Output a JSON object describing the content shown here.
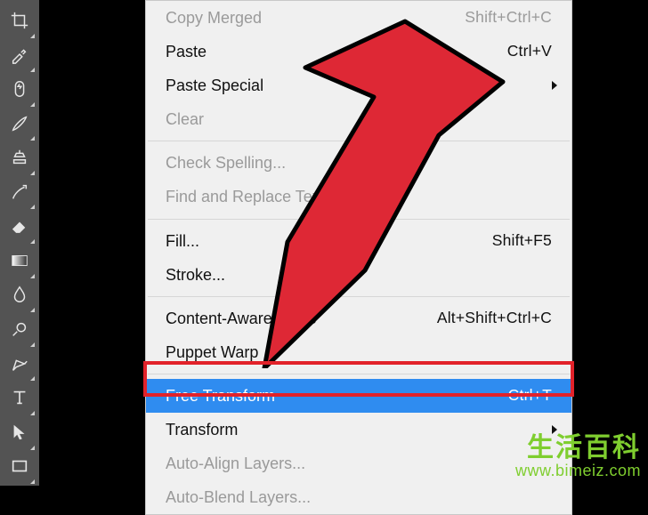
{
  "toolbar": {
    "tools": [
      {
        "name": "crop-tool"
      },
      {
        "name": "eyedropper-tool"
      },
      {
        "name": "healing-brush-tool"
      },
      {
        "name": "brush-tool"
      },
      {
        "name": "clone-stamp-tool"
      },
      {
        "name": "history-brush-tool"
      },
      {
        "name": "eraser-tool"
      },
      {
        "name": "gradient-tool"
      },
      {
        "name": "blur-tool"
      },
      {
        "name": "dodge-tool"
      },
      {
        "name": "pen-tool"
      },
      {
        "name": "type-tool"
      },
      {
        "name": "path-selection-tool"
      },
      {
        "name": "rectangle-tool"
      }
    ]
  },
  "menu": {
    "groups": [
      [
        {
          "label": "Copy Merged",
          "shortcut": "Shift+Ctrl+C",
          "enabled": false
        },
        {
          "label": "Paste",
          "shortcut": "Ctrl+V",
          "enabled": true
        },
        {
          "label": "Paste Special",
          "submenu": true,
          "enabled": true
        },
        {
          "label": "Clear",
          "enabled": false
        }
      ],
      [
        {
          "label": "Check Spelling...",
          "enabled": false
        },
        {
          "label": "Find and Replace Text...",
          "enabled": false
        }
      ],
      [
        {
          "label": "Fill...",
          "shortcut": "Shift+F5",
          "enabled": true
        },
        {
          "label": "Stroke...",
          "enabled": true
        }
      ],
      [
        {
          "label": "Content-Aware Scale",
          "shortcut": "Alt+Shift+Ctrl+C",
          "enabled": true
        },
        {
          "label": "Puppet Warp",
          "enabled": true
        }
      ],
      [
        {
          "label": "Free Transform",
          "shortcut": "Ctrl+T",
          "enabled": true,
          "highlight": true
        },
        {
          "label": "Transform",
          "submenu": true,
          "enabled": true
        },
        {
          "label": "Auto-Align Layers...",
          "enabled": false
        },
        {
          "label": "Auto-Blend Layers...",
          "enabled": false
        }
      ]
    ]
  },
  "annotation": {
    "arrow_color": "#de2835",
    "arrow_stroke": "#000"
  },
  "watermark": {
    "text_cn": "生活百科",
    "url": "www.bimeiz.com"
  }
}
